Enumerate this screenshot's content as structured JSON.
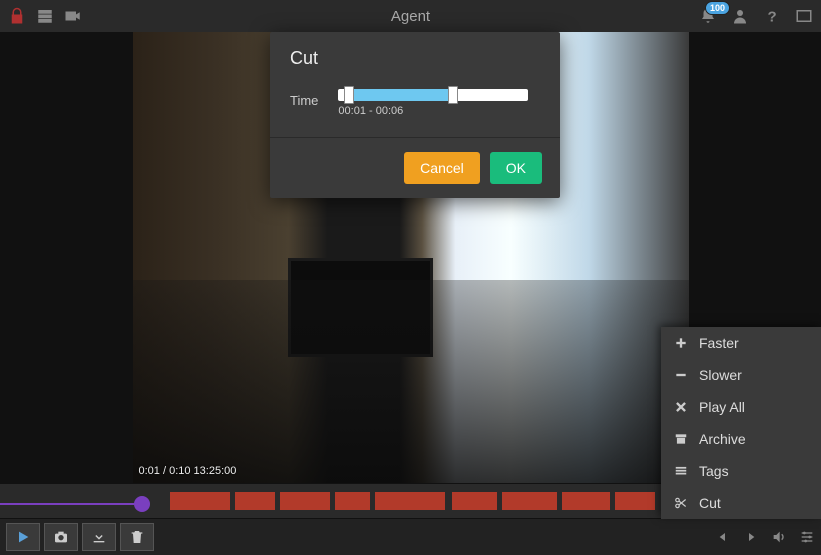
{
  "header": {
    "title": "Agent",
    "badge_count": "100"
  },
  "video": {
    "timestamp": "0:01 / 0:10  13:25:00"
  },
  "context_menu": {
    "items": [
      {
        "icon": "plus",
        "label": "Faster"
      },
      {
        "icon": "minus",
        "label": "Slower"
      },
      {
        "icon": "x",
        "label": "Play All"
      },
      {
        "icon": "box",
        "label": "Archive"
      },
      {
        "icon": "list",
        "label": "Tags"
      },
      {
        "icon": "scissor",
        "label": "Cut"
      }
    ]
  },
  "modal": {
    "title": "Cut",
    "time_label": "Time",
    "time_range": "00:01 - 00:06",
    "slider": {
      "start_pct": 5,
      "end_pct": 60
    },
    "cancel": "Cancel",
    "ok": "OK"
  },
  "colors": {
    "accent_purple": "#7a3fbf",
    "accent_blue": "#6ec8f0",
    "btn_cancel": "#f0a020",
    "btn_ok": "#1abc7c",
    "timeline_red": "#b23a2a"
  }
}
